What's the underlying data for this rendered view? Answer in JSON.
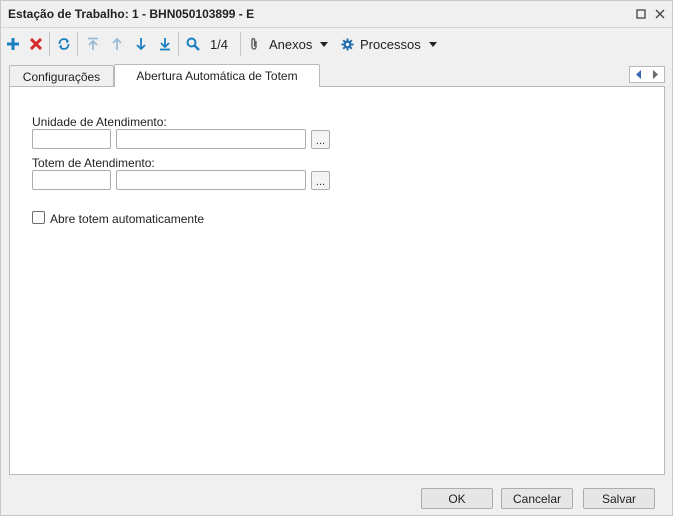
{
  "window": {
    "title": "Estação de Trabalho: 1 - BHN050103899 - E"
  },
  "toolbar": {
    "record_counter": "1/4",
    "attachments_label": "Anexos",
    "processes_label": "Processos",
    "icons": [
      "add-icon",
      "delete-icon",
      "refresh-icon",
      "first-record-icon",
      "previous-record-icon",
      "next-record-icon",
      "last-record-icon",
      "search-icon",
      "paperclip-icon",
      "gear-icon"
    ],
    "colors": {
      "add": "#1a7fc1",
      "delete": "#d42b2b",
      "nav": "#1a7fc1",
      "nav_disabled": "#9bbcd6"
    }
  },
  "tabs": [
    {
      "label": "Configurações",
      "active": false
    },
    {
      "label": "Abertura Automática de Totem",
      "active": true
    }
  ],
  "form": {
    "unidade_label": "Unidade de Atendimento:",
    "unidade_code": "",
    "unidade_name": "",
    "totem_label": "Totem de Atendimento:",
    "totem_code": "",
    "totem_name": "",
    "lookup_button": "...",
    "checkbox_label": "Abre totem automaticamente",
    "checkbox_checked": false
  },
  "footer": {
    "ok_label": "OK",
    "cancel_label": "Cancelar",
    "save_label": "Salvar"
  }
}
